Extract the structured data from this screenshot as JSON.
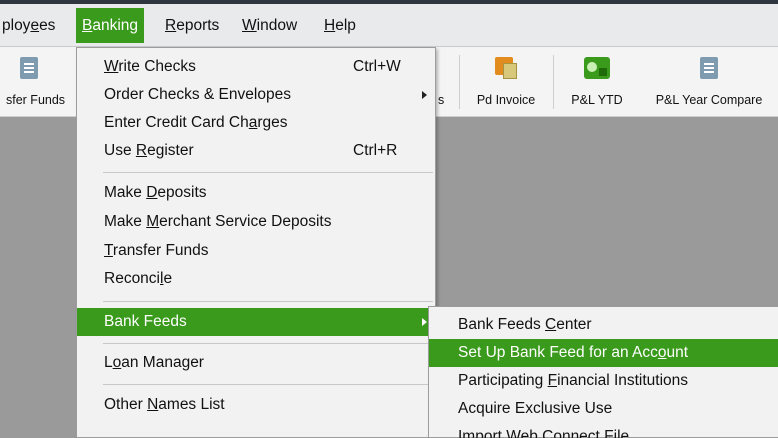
{
  "menubar": {
    "items": [
      {
        "pre": "ploy",
        "u": "e",
        "post": "es"
      },
      {
        "pre": "",
        "u": "B",
        "post": "anking"
      },
      {
        "pre": "",
        "u": "R",
        "post": "eports"
      },
      {
        "pre": "",
        "u": "W",
        "post": "indow"
      },
      {
        "pre": "",
        "u": "H",
        "post": "elp"
      }
    ]
  },
  "toolbar": {
    "transfer_funds": "sfer Funds",
    "partial_label": "s",
    "pd_invoice": "Pd Invoice",
    "pl_ytd": "P&L YTD",
    "pl_year_compare": "P&L Year Compare"
  },
  "banking_menu": {
    "items": [
      {
        "pre": "",
        "u": "W",
        "post": "rite Checks",
        "shortcut": "Ctrl+W"
      },
      {
        "pre": "Order Checks & Envelopes",
        "u": "",
        "post": ""
      },
      {
        "pre": "Enter Credit Card Ch",
        "u": "a",
        "post": "rges"
      },
      {
        "pre": "Use ",
        "u": "R",
        "post": "egister",
        "shortcut": "Ctrl+R"
      },
      {
        "pre": "Make ",
        "u": "D",
        "post": "eposits"
      },
      {
        "pre": "Make ",
        "u": "M",
        "post": "erchant Service Deposits"
      },
      {
        "pre": "",
        "u": "T",
        "post": "ransfer Funds"
      },
      {
        "pre": "Reconci",
        "u": "l",
        "post": "e"
      },
      {
        "pre": "Bank Feeds",
        "u": "",
        "post": ""
      },
      {
        "pre": "L",
        "u": "o",
        "post": "an Manager"
      },
      {
        "pre": "Other ",
        "u": "N",
        "post": "ames List"
      }
    ]
  },
  "bank_feeds_submenu": {
    "items": [
      {
        "pre": "Bank Feeds ",
        "u": "C",
        "post": "enter"
      },
      {
        "pre": "Set Up Bank Feed for an Acc",
        "u": "o",
        "post": "unt"
      },
      {
        "pre": "Participating ",
        "u": "F",
        "post": "inancial Institutions"
      },
      {
        "pre": "Acquire Exclusive Use",
        "u": "",
        "post": ""
      },
      {
        "pre": "Import Web Connect File",
        "u": "",
        "post": ""
      }
    ]
  },
  "colors": {
    "accent_green": "#3a9a1c",
    "menu_background": "#f2f2f2",
    "workspace_gray": "#9a9a9a"
  },
  "icons": {
    "transfer_funds": "document-icon",
    "pd_invoice": "invoice-icon",
    "pl_ytd": "money-report-icon",
    "pl_year_compare": "document-icon"
  }
}
